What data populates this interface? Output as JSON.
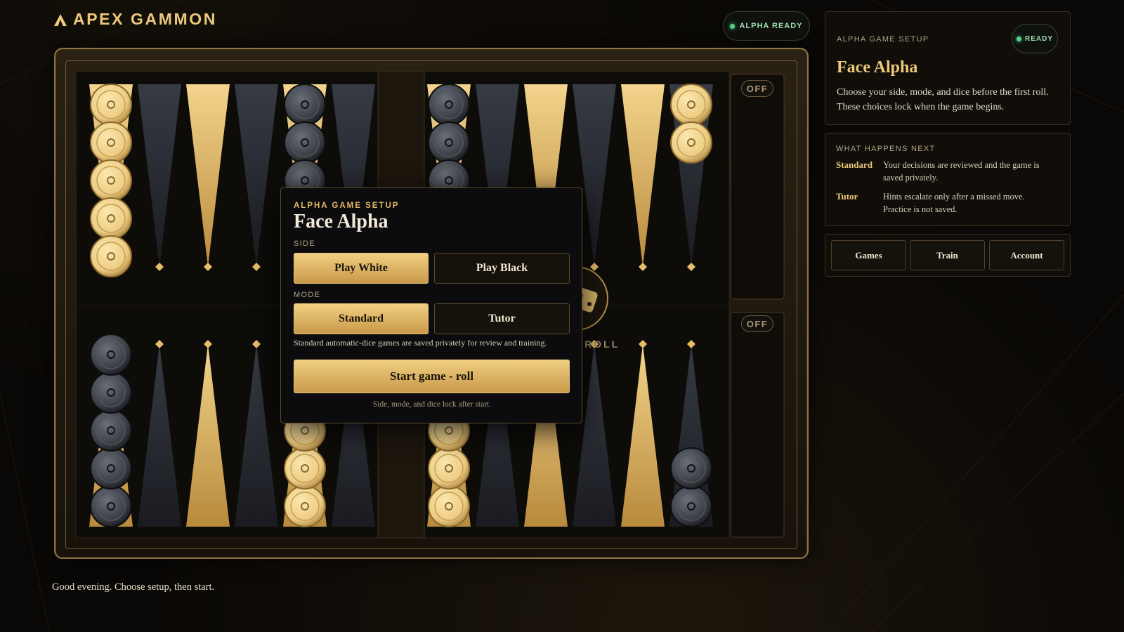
{
  "app": {
    "name": "APEX GAMMON"
  },
  "header": {
    "status_label": "ALPHA READY"
  },
  "board": {
    "off_label": "OFF",
    "roll_label": "TO ROLL",
    "checkers": {
      "top": [
        {
          "color": "light",
          "count": 5
        },
        {
          "color": null,
          "count": 0
        },
        {
          "color": null,
          "count": 0
        },
        {
          "color": null,
          "count": 0
        },
        {
          "color": "dark",
          "count": 3
        },
        {
          "color": null,
          "count": 0
        },
        {
          "color": "dark",
          "count": 3
        },
        {
          "color": null,
          "count": 0
        },
        {
          "color": null,
          "count": 0
        },
        {
          "color": null,
          "count": 0
        },
        {
          "color": null,
          "count": 0
        },
        {
          "color": "light",
          "count": 2
        }
      ],
      "bottom": [
        {
          "color": "dark",
          "count": 5
        },
        {
          "color": null,
          "count": 0
        },
        {
          "color": null,
          "count": 0
        },
        {
          "color": null,
          "count": 0
        },
        {
          "color": "light",
          "count": 3
        },
        {
          "color": null,
          "count": 0
        },
        {
          "color": "light",
          "count": 3
        },
        {
          "color": null,
          "count": 0
        },
        {
          "color": null,
          "count": 0
        },
        {
          "color": null,
          "count": 0
        },
        {
          "color": null,
          "count": 0
        },
        {
          "color": "dark",
          "count": 2
        }
      ]
    },
    "colors": {
      "gold_point": "#e6bd6a",
      "dark_point": "#2c303a",
      "light_checker": "#eccd84",
      "dark_checker": "#3a3d44"
    }
  },
  "setup_modal": {
    "eyebrow": "ALPHA GAME SETUP",
    "title": "Face Alpha",
    "side_label": "SIDE",
    "side_options": [
      "Play White",
      "Play Black"
    ],
    "side_selected": "Play White",
    "mode_label": "MODE",
    "mode_options": [
      "Standard",
      "Tutor"
    ],
    "mode_selected": "Standard",
    "description": "Standard automatic-dice games are saved privately for review and training.",
    "start_button": "Start game - roll",
    "footnote": "Side, mode, and dice lock after start."
  },
  "side_panel": {
    "setup": {
      "eyebrow": "ALPHA GAME SETUP",
      "status": "READY",
      "title": "Face Alpha",
      "description": "Choose your side, mode, and dice before the first roll. These choices lock when the game begins."
    },
    "next": {
      "eyebrow": "WHAT HAPPENS NEXT",
      "items": [
        {
          "term": "Standard",
          "definition": "Your decisions are reviewed and the game is saved privately."
        },
        {
          "term": "Tutor",
          "definition": "Hints escalate only after a missed move. Practice is not saved."
        }
      ]
    },
    "nav": [
      "Games",
      "Train",
      "Account"
    ]
  },
  "footer": {
    "greeting": "Good evening. Choose setup, then start."
  },
  "accent": {
    "gold": "#edc97b",
    "ready_green": "#56d38a"
  }
}
